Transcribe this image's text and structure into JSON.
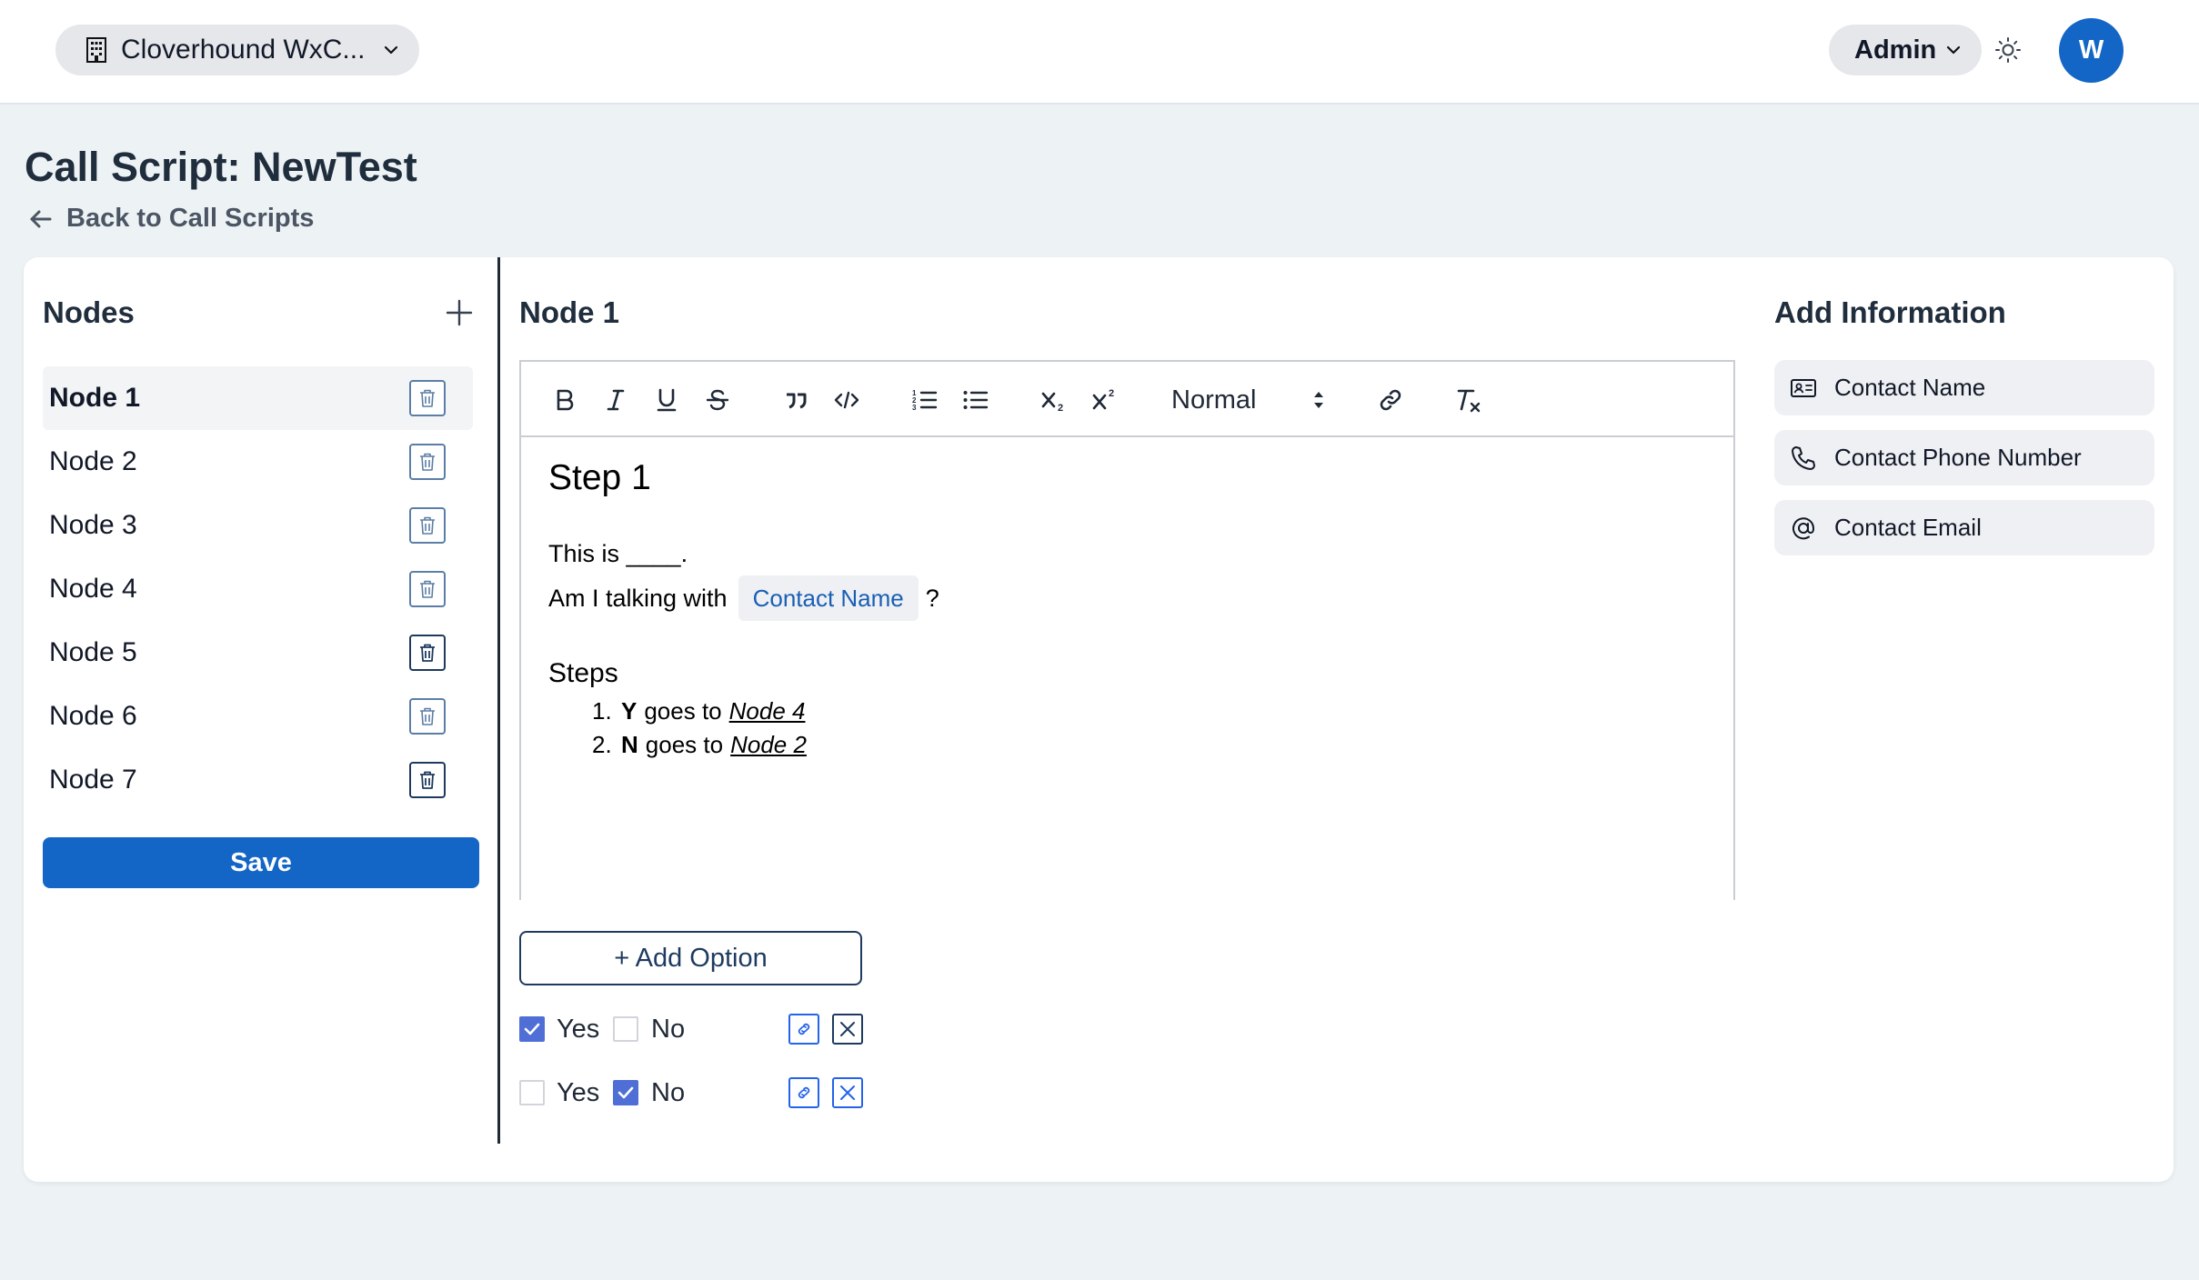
{
  "topbar": {
    "org_name": "Cloverhound WxC...",
    "role": "Admin",
    "avatar_initial": "W"
  },
  "header": {
    "title": "Call Script: NewTest",
    "back_link": "Back to Call Scripts"
  },
  "nodes_panel": {
    "title": "Nodes",
    "items": [
      {
        "label": "Node 1",
        "active": true
      },
      {
        "label": "Node 2"
      },
      {
        "label": "Node 3"
      },
      {
        "label": "Node 4"
      },
      {
        "label": "Node 5"
      },
      {
        "label": "Node 6"
      },
      {
        "label": "Node 7"
      }
    ],
    "save_label": "Save"
  },
  "editor": {
    "title": "Node 1",
    "toolbar": {
      "format_select": "Normal",
      "icons": [
        "bold-icon",
        "italic-icon",
        "underline-icon",
        "strikethrough-icon",
        "blockquote-icon",
        "code-icon",
        "ordered-list-icon",
        "bullet-list-icon",
        "subscript-icon",
        "superscript-icon",
        "link-icon",
        "clear-format-icon"
      ]
    },
    "content": {
      "heading": "Step 1",
      "line1": "This is ____.",
      "line2_prefix": "Am I talking with",
      "chip": "Contact Name",
      "line2_suffix": "?",
      "steps_heading": "Steps",
      "steps": [
        {
          "num": "1.",
          "key": "Y",
          "text": "goes to",
          "target": "Node 4"
        },
        {
          "num": "2.",
          "key": "N",
          "text": "goes to",
          "target": "Node 2"
        }
      ]
    },
    "add_option_label": "+ Add Option",
    "options": [
      {
        "yes_label": "Yes",
        "no_label": "No",
        "selected": "Yes"
      },
      {
        "yes_label": "Yes",
        "no_label": "No",
        "selected": "No"
      }
    ]
  },
  "info_panel": {
    "title": "Add Information",
    "items": [
      {
        "label": "Contact Name",
        "icon": "contact-card-icon"
      },
      {
        "label": "Contact Phone Number",
        "icon": "phone-icon"
      },
      {
        "label": "Contact Email",
        "icon": "at-sign-icon"
      }
    ]
  },
  "colors": {
    "primary": "#1366c6",
    "checkbox": "#4f6fd6",
    "chip_text": "#1a5fb4",
    "background": "#edf2f5"
  }
}
